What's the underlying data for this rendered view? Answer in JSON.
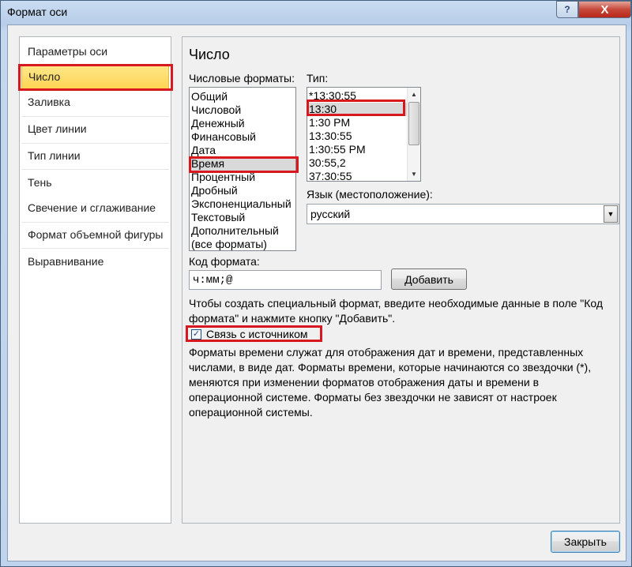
{
  "window": {
    "title": "Формат оси",
    "help_label": "?",
    "close_label": "X"
  },
  "nav": {
    "items": [
      {
        "label": "Параметры оси"
      },
      {
        "label": "Число"
      },
      {
        "label": "Заливка"
      },
      {
        "label": "Цвет линии"
      },
      {
        "label": "Тип линии"
      },
      {
        "label": "Тень"
      },
      {
        "label": "Свечение и сглаживание"
      },
      {
        "label": "Формат объемной фигуры"
      },
      {
        "label": "Выравнивание"
      }
    ],
    "selected": "Число"
  },
  "panel": {
    "heading": "Число",
    "categories_label": "Числовые форматы:",
    "categories": [
      "Общий",
      "Числовой",
      "Денежный",
      "Финансовый",
      "Дата",
      "Время",
      "Процентный",
      "Дробный",
      "Экспоненциальный",
      "Текстовый",
      "Дополнительный",
      "(все форматы)"
    ],
    "selected_category": "Время",
    "type_label": "Тип:",
    "types": [
      "*13:30:55",
      "13:30",
      "1:30 PM",
      "13:30:55",
      "1:30:55 PM",
      "30:55,2",
      "37:30:55"
    ],
    "selected_type": "13:30",
    "locale_label": "Язык (местоположение):",
    "locale_value": "русский",
    "format_code_label": "Код формата:",
    "format_code_value": "ч:мм;@",
    "add_button": "Добавить",
    "hint": "Чтобы создать специальный формат, введите необходимые данные в поле \"Код формата\" и нажмите кнопку \"Добавить\".",
    "link_source_label": "Связь с источником",
    "link_source_checked": true,
    "description": "Форматы времени служат для отображения дат и времени, представленных числами, в виде дат. Форматы времени, которые начинаются со звездочки (*), меняются при изменении форматов отображения даты и времени в операционной системе. Форматы без звездочки не зависят от настроек операционной системы."
  },
  "footer": {
    "close_button": "Закрыть"
  },
  "colors": {
    "highlight_box": "#d7191f",
    "nav_selected": "#fdd454"
  }
}
